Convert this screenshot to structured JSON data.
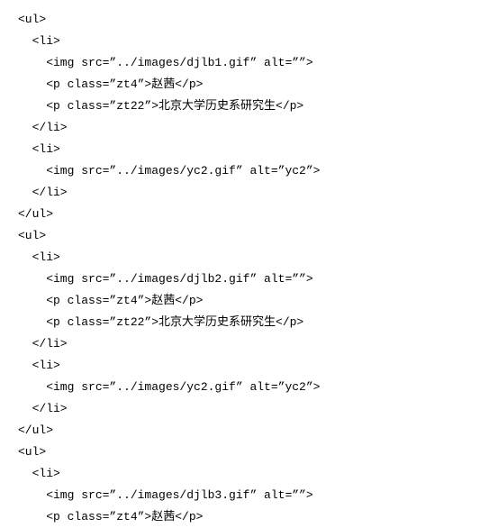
{
  "lines": [
    {
      "indent": 0,
      "text": "<ul>"
    },
    {
      "indent": 1,
      "text": "<li>"
    },
    {
      "indent": 2,
      "text": "<img src=\"../images/djlb1.gif\" alt=\"\">"
    },
    {
      "indent": 2,
      "text": "<p class=\"zt4\">赵茜</p>"
    },
    {
      "indent": 2,
      "text": "<p class=\"zt22\">北京大学历史系研究生</p>"
    },
    {
      "indent": 1,
      "text": "</li>"
    },
    {
      "indent": 1,
      "text": "<li>"
    },
    {
      "indent": 2,
      "text": "<img src=\"../images/yc2.gif\" alt=\"yc2\">"
    },
    {
      "indent": 1,
      "text": "</li>"
    },
    {
      "indent": 0,
      "text": "</ul>"
    },
    {
      "indent": 0,
      "text": "<ul>"
    },
    {
      "indent": 1,
      "text": "<li>"
    },
    {
      "indent": 2,
      "text": "<img src=\"../images/djlb2.gif\" alt=\"\">"
    },
    {
      "indent": 2,
      "text": "<p class=\"zt4\">赵茜</p>"
    },
    {
      "indent": 2,
      "text": "<p class=\"zt22\">北京大学历史系研究生</p>"
    },
    {
      "indent": 1,
      "text": "</li>"
    },
    {
      "indent": 1,
      "text": "<li>"
    },
    {
      "indent": 2,
      "text": "<img src=\"../images/yc2.gif\" alt=\"yc2\">"
    },
    {
      "indent": 1,
      "text": "</li>"
    },
    {
      "indent": 0,
      "text": "</ul>"
    },
    {
      "indent": 0,
      "text": "<ul>"
    },
    {
      "indent": 1,
      "text": "<li>"
    },
    {
      "indent": 2,
      "text": "<img src=\"../images/djlb3.gif\" alt=\"\">"
    },
    {
      "indent": 2,
      "text": "<p class=\"zt4\">赵茜</p>"
    }
  ],
  "indentUnit": "  "
}
